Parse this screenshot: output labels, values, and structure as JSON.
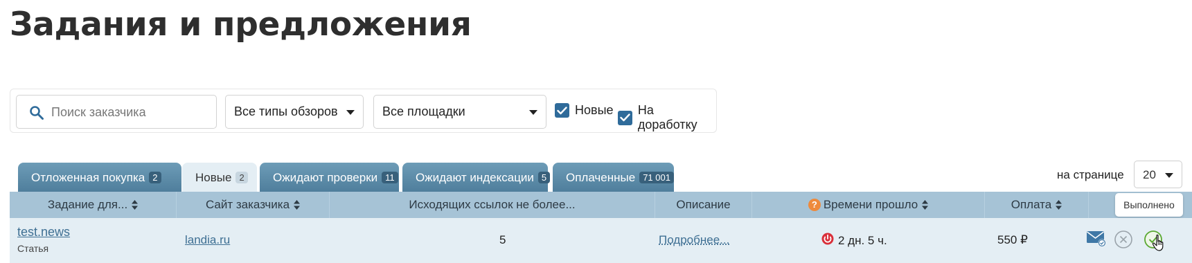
{
  "page": {
    "title": "Задания и предложения"
  },
  "filters": {
    "search_placeholder": "Поиск заказчика",
    "review_type": "Все типы обзоров",
    "platform": "Все площадки",
    "checkbox_new": {
      "label": "Новые",
      "checked": true
    },
    "checkbox_rework": {
      "label": "На доработку",
      "checked": true
    }
  },
  "tabs": [
    {
      "label": "Отложенная покупка",
      "count": "2",
      "active": false
    },
    {
      "label": "Новые",
      "count": "2",
      "active": true
    },
    {
      "label": "Ожидают проверки",
      "count": "11",
      "active": false
    },
    {
      "label": "Ожидают индексации",
      "count": "5",
      "active": false
    },
    {
      "label": "Оплаченные",
      "count": "71 001",
      "active": false
    }
  ],
  "pagination": {
    "label": "на странице",
    "per_page": "20"
  },
  "table": {
    "headers": {
      "task": "Задание для...",
      "site": "Сайт заказчика",
      "links": "Исходящих ссылок не более...",
      "description": "Описание",
      "elapsed": "Времени прошло",
      "payment": "Оплата"
    },
    "rows": [
      {
        "task": "test.news",
        "type": "Статья",
        "site": "landia.ru",
        "links": "5",
        "description": "Подробнее...",
        "elapsed": "2 дн. 5 ч.",
        "payment": "550 ₽"
      }
    ]
  },
  "tooltip": {
    "text": "Выполнено"
  },
  "colors": {
    "tab_bg": "#5f8fad",
    "tab_active_bg": "#e4eef4",
    "table_header_bg": "#a6c3d6",
    "row_bg": "#e4eef4",
    "accent": "#2f6b9a",
    "help_icon": "#ee8a3c",
    "timer_icon": "#d92f3a",
    "done_icon": "#5aa832"
  },
  "icons": {
    "search": "search-icon",
    "help": "question-icon",
    "timer": "timer-icon",
    "mail": "mail-check-icon",
    "cancel": "cancel-icon",
    "done": "check-circle-icon"
  }
}
